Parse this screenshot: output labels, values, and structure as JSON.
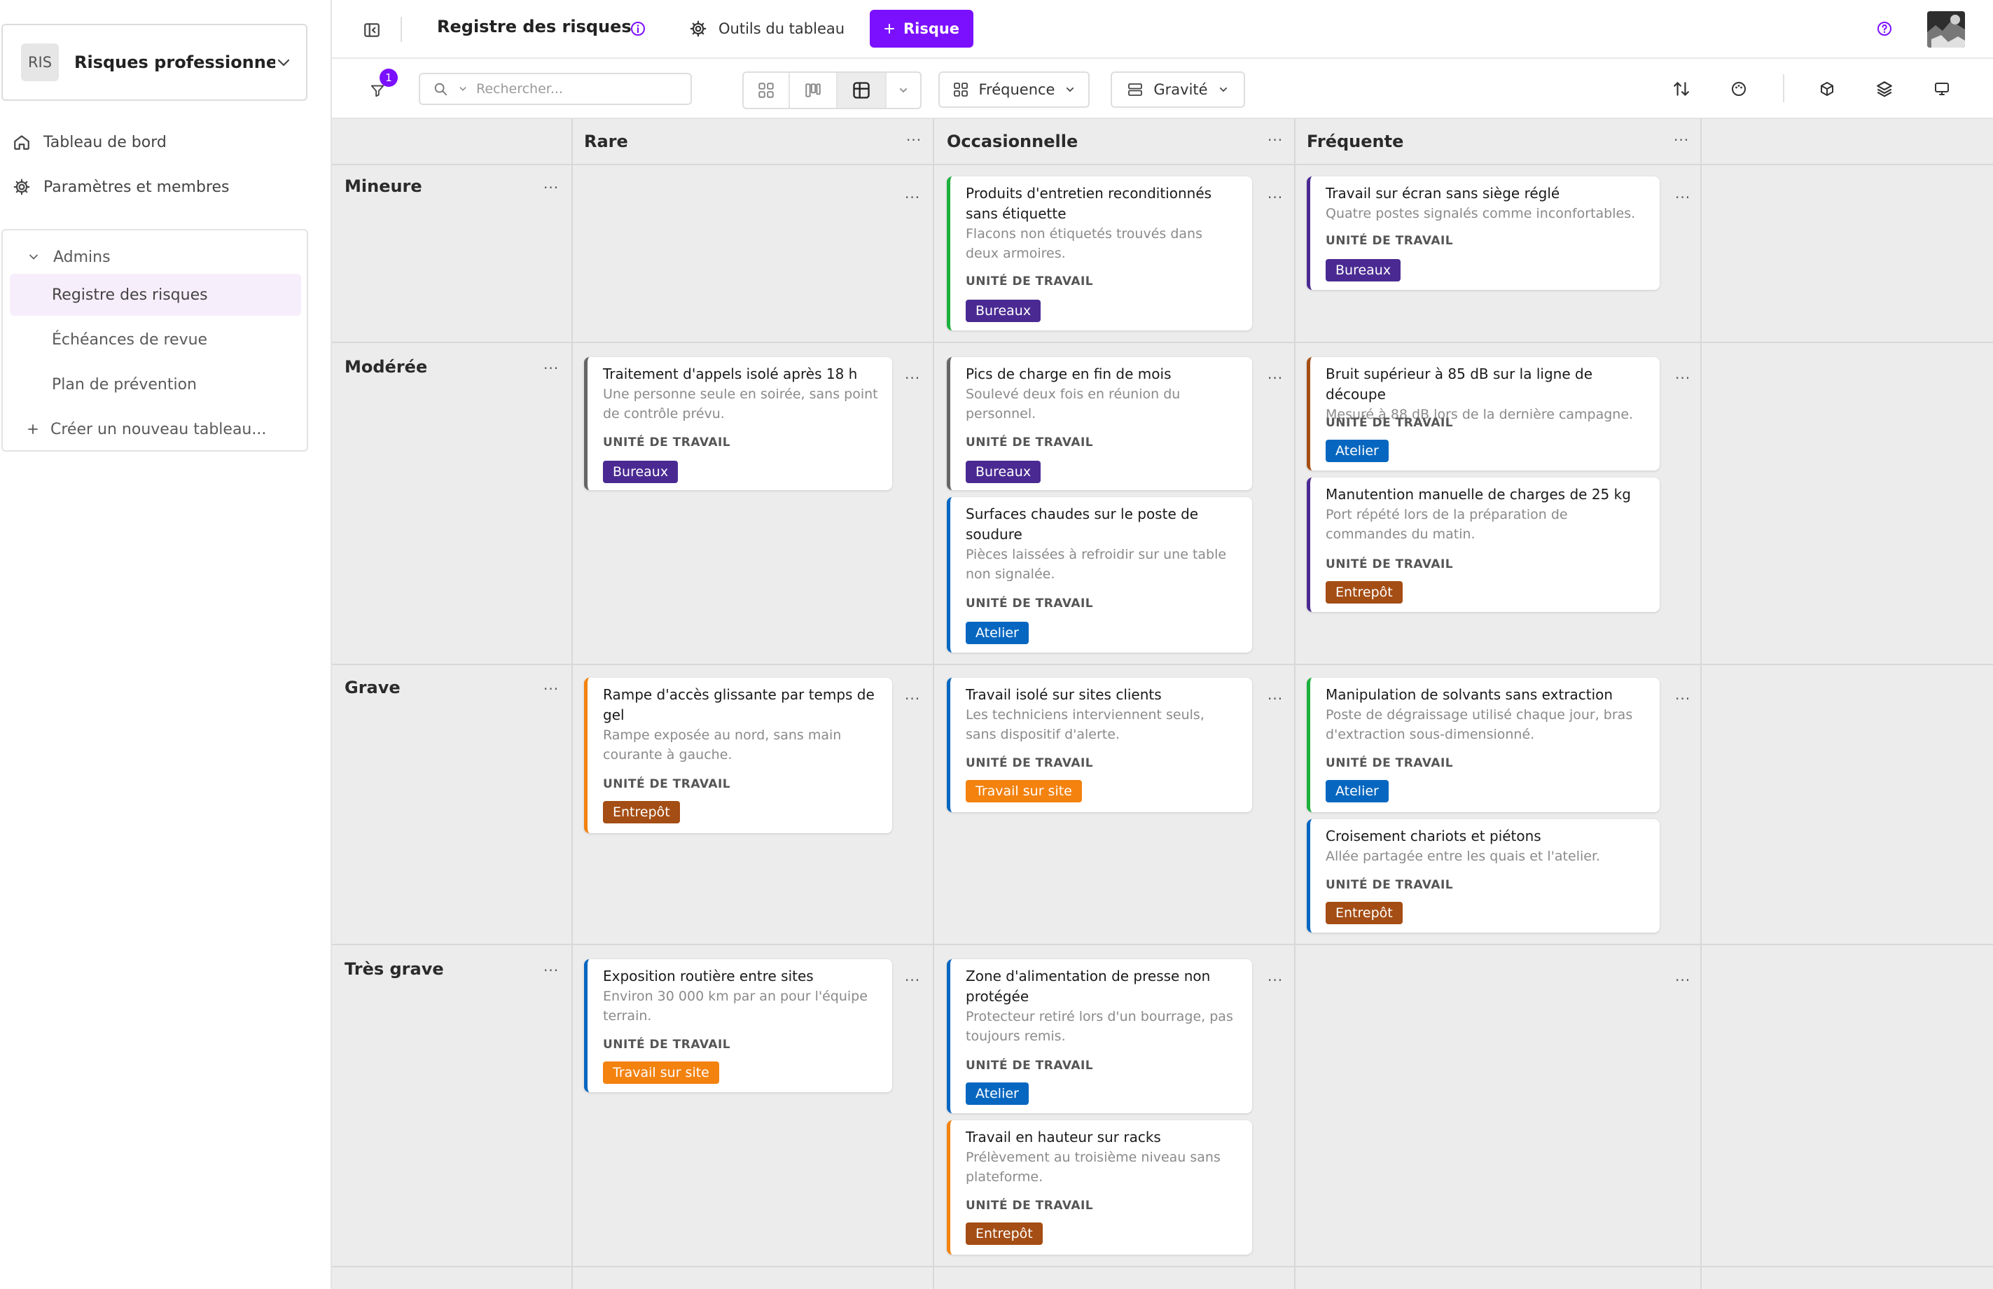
{
  "sidebar": {
    "workspace": {
      "initials": "RIS",
      "name": "Risques professionne..."
    },
    "nav": [
      {
        "label": "Tableau de bord"
      },
      {
        "label": "Paramètres et membres"
      }
    ],
    "group": {
      "label": "Admins",
      "items": [
        {
          "label": "Registre des risques"
        },
        {
          "label": "Échéances de revue"
        },
        {
          "label": "Plan de prévention"
        }
      ]
    },
    "create_label": "Créer un nouveau tableau..."
  },
  "topbar": {
    "title": "Registre des risques",
    "tools_label": "Outils du tableau",
    "add_label": "Risque"
  },
  "toolbar": {
    "filter_count": "1",
    "search_placeholder": "Rechercher...",
    "group_cols_label": "Fréquence",
    "group_rows_label": "Gravité"
  },
  "colors": {
    "accent": "#7b10ff",
    "bureaux": "#4a2a92",
    "atelier": "#0767c0",
    "entrepot": "#a44d14",
    "travail": "#f3820f",
    "border_green": "#1bb13c",
    "border_gray": "#666666"
  },
  "board": {
    "columns": [
      {
        "label": "Rare"
      },
      {
        "label": "Occasionnelle"
      },
      {
        "label": "Fréquente"
      }
    ],
    "rows": [
      {
        "label": "Mineure"
      },
      {
        "label": "Modérée"
      },
      {
        "label": "Grave"
      },
      {
        "label": "Très grave"
      }
    ],
    "field_label": "UNITÉ DE TRAVAIL",
    "cards": {
      "r0c1a": {
        "title": "Produits d'entretien reconditionnés sans étiquette",
        "desc": "Flacons non étiquetés trouvés dans deux armoires.",
        "tag": "Bureaux"
      },
      "r0c2a": {
        "title": "Travail sur écran sans siège réglé",
        "desc": "Quatre postes signalés comme inconfortables.",
        "tag": "Bureaux"
      },
      "r1c0a": {
        "title": "Traitement d'appels isolé après 18 h",
        "desc": "Une personne seule en soirée, sans point de contrôle prévu.",
        "tag": "Bureaux"
      },
      "r1c1a": {
        "title": "Pics de charge en fin de mois",
        "desc": "Soulevé deux fois en réunion du personnel.",
        "tag": "Bureaux"
      },
      "r1c1b": {
        "title": "Surfaces chaudes sur le poste de soudure",
        "desc": "Pièces laissées à refroidir sur une table non signalée.",
        "tag": "Atelier"
      },
      "r1c2a": {
        "title": "Bruit supérieur à 85 dB sur la ligne de découpe",
        "desc": "Mesuré à 88 dB lors de la dernière campagne.",
        "tag": "Atelier"
      },
      "r1c2b": {
        "title": "Manutention manuelle de charges de 25 kg",
        "desc": "Port répété lors de la préparation de commandes du matin.",
        "tag": "Entrepôt"
      },
      "r2c0a": {
        "title": "Rampe d'accès glissante par temps de gel",
        "desc": "Rampe exposée au nord, sans main courante à gauche.",
        "tag": "Entrepôt"
      },
      "r2c1a": {
        "title": "Travail isolé sur sites clients",
        "desc": "Les techniciens interviennent seuls, sans dispositif d'alerte.",
        "tag": "Travail sur site"
      },
      "r2c2a": {
        "title": "Manipulation de solvants sans extraction",
        "desc": "Poste de dégraissage utilisé chaque jour, bras d'extraction sous-dimensionné.",
        "tag": "Atelier"
      },
      "r2c2b": {
        "title": "Croisement chariots et piétons",
        "desc": "Allée partagée entre les quais et l'atelier.",
        "tag": "Entrepôt"
      },
      "r3c0a": {
        "title": "Exposition routière entre sites",
        "desc": "Environ 30 000 km par an pour l'équipe terrain.",
        "tag": "Travail sur site"
      },
      "r3c1a": {
        "title": "Zone d'alimentation de presse non protégée",
        "desc": "Protecteur retiré lors d'un bourrage, pas toujours remis.",
        "tag": "Atelier"
      },
      "r3c1b": {
        "title": "Travail en hauteur sur racks",
        "desc": "Prélèvement au troisième niveau sans plateforme.",
        "tag": "Entrepôt"
      }
    }
  }
}
